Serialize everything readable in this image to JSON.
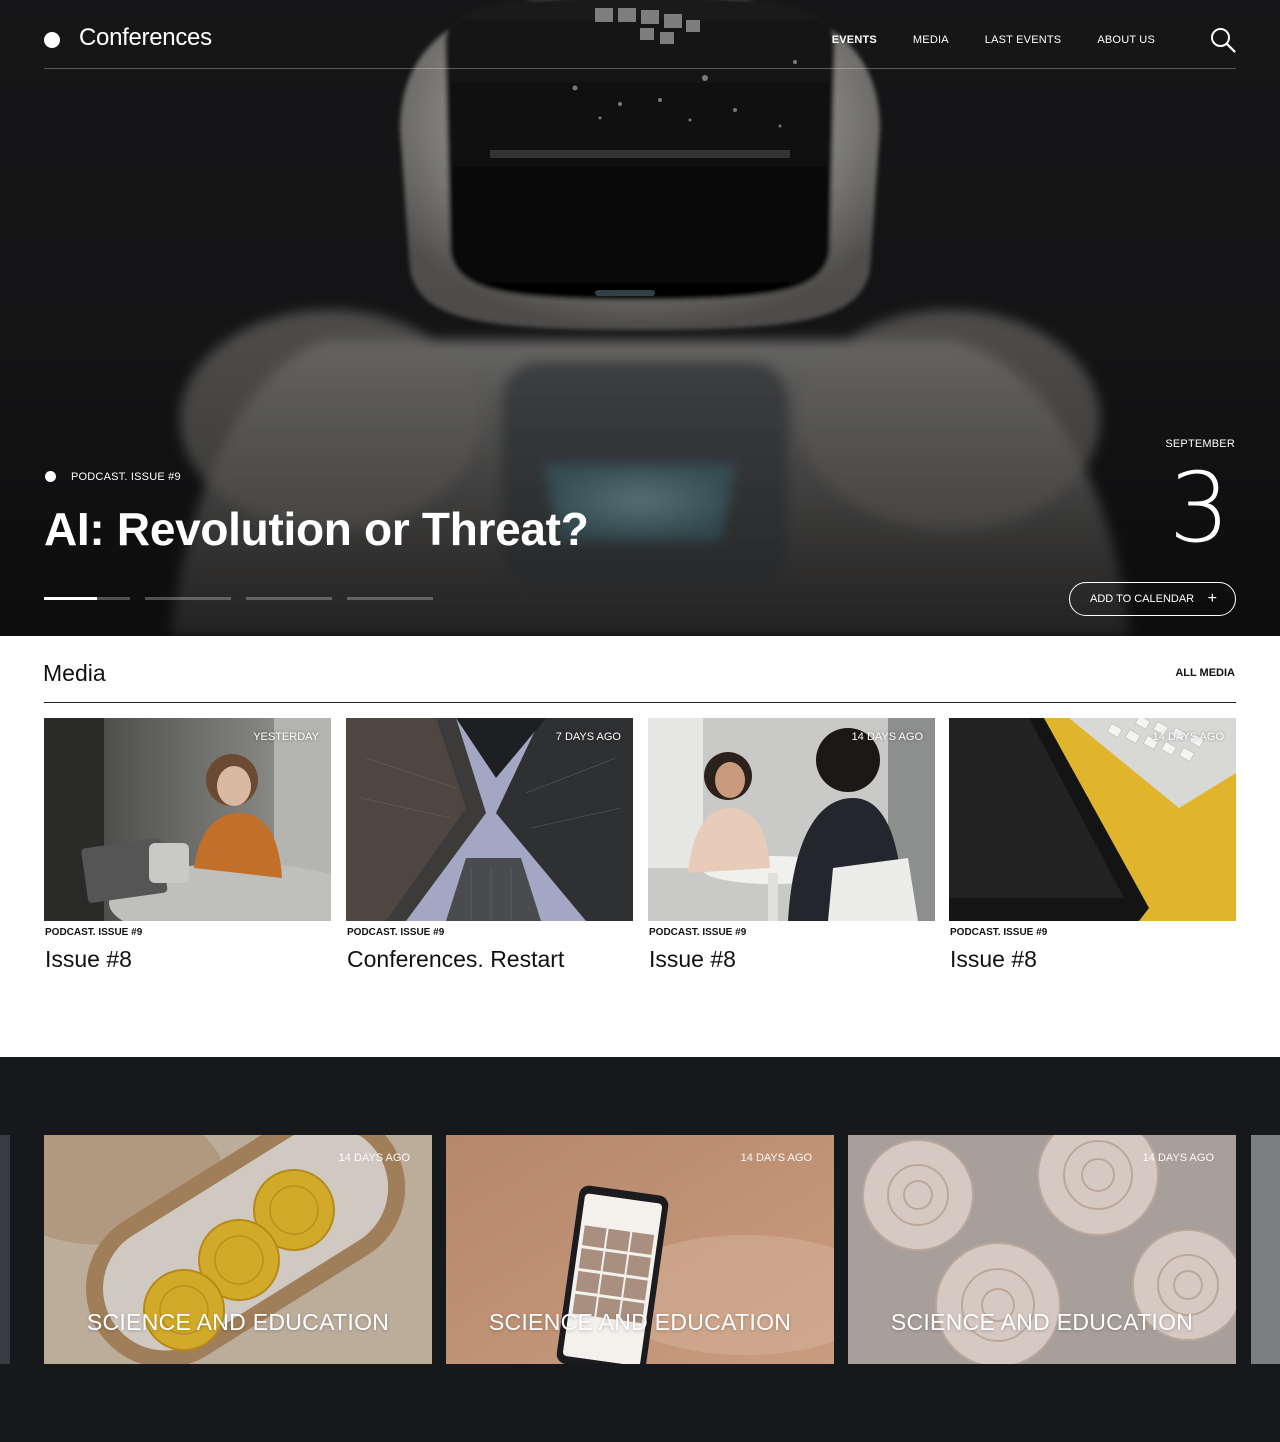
{
  "header": {
    "brand": "Conferences",
    "nav": [
      {
        "label": "EVENTS",
        "active": true
      },
      {
        "label": "MEDIA",
        "active": false
      },
      {
        "label": "LAST EVENTS",
        "active": false
      },
      {
        "label": "ABOUT US",
        "active": false
      }
    ],
    "search_icon": "search-icon"
  },
  "hero": {
    "tag": "PODCAST. ISSUE #9",
    "title": "AI: Revolution or Threat?",
    "date_month": "SEPTEMBER",
    "date_day": "3",
    "add_to_calendar": "ADD TO CALENDAR",
    "add_icon": "plus-icon",
    "slides_total": 4,
    "active_slide": 1,
    "active_slide_progress": 0.62
  },
  "media": {
    "title": "Media",
    "all_link": "ALL MEDIA",
    "cards": [
      {
        "age": "YESTERDAY",
        "category": "PODCAST. ISSUE #9",
        "title": "Issue #8"
      },
      {
        "age": "7 DAYS AGO",
        "category": "PODCAST. ISSUE #9",
        "title": "Conferences. Restart"
      },
      {
        "age": "14 DAYS AGO",
        "category": "PODCAST. ISSUE #9",
        "title": "Issue #8"
      },
      {
        "age": "14 DAYS AGO",
        "category": "PODCAST. ISSUE #9",
        "title": "Issue #8"
      }
    ]
  },
  "topics": {
    "tiles": [
      {
        "age": "14 DAYS AGO",
        "label": "SCIENCE AND EDUCATION"
      },
      {
        "age": "14 DAYS AGO",
        "label": "SCIENCE AND EDUCATION"
      },
      {
        "age": "14 DAYS AGO",
        "label": "SCIENCE AND EDUCATION"
      }
    ]
  },
  "colors": {
    "hero_bg": "#1b1b1d",
    "dark_section_bg": "#17181c",
    "text_dark": "#111111",
    "accent_yellow": "#e0b52c"
  }
}
